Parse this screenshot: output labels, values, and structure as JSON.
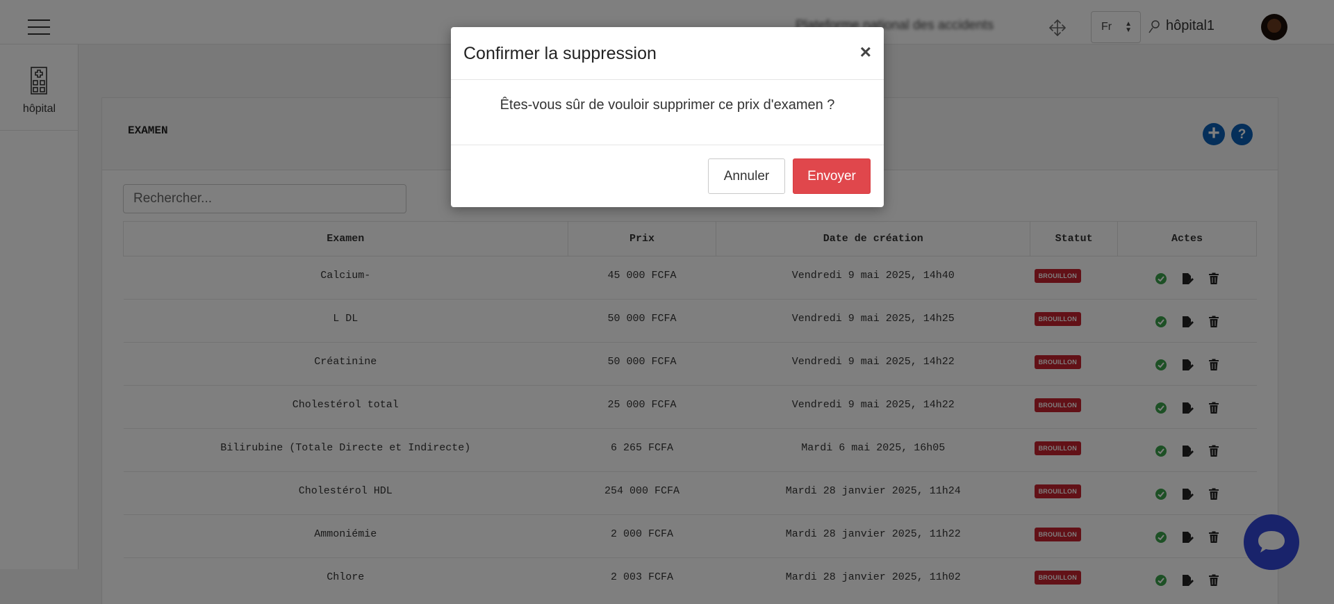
{
  "header": {
    "brand_text": "Plateforme national des accidents",
    "language": "Fr",
    "user_name": "hôpital1"
  },
  "sidebar": {
    "items": [
      {
        "label": "hôpital",
        "icon": "hospital-icon"
      }
    ]
  },
  "page": {
    "title": "EXAMEN",
    "search_placeholder": "Rechercher..."
  },
  "table": {
    "columns": [
      "Examen",
      "Prix",
      "Date de création",
      "Statut",
      "Actes"
    ],
    "rows": [
      {
        "examen": "Calcium-",
        "prix": "45 000 FCFA",
        "date": "Vendredi 9 mai 2025, 14h40",
        "statut": "BROUILLON"
      },
      {
        "examen": "L DL",
        "prix": "50 000 FCFA",
        "date": "Vendredi 9 mai 2025, 14h25",
        "statut": "BROUILLON"
      },
      {
        "examen": "Créatinine",
        "prix": "50 000 FCFA",
        "date": "Vendredi 9 mai 2025, 14h22",
        "statut": "BROUILLON"
      },
      {
        "examen": "Cholestérol total",
        "prix": "25 000 FCFA",
        "date": "Vendredi 9 mai 2025, 14h22",
        "statut": "BROUILLON"
      },
      {
        "examen": "Bilirubine (Totale Directe et Indirecte)",
        "prix": "6 265 FCFA",
        "date": "Mardi 6 mai 2025, 16h05",
        "statut": "BROUILLON"
      },
      {
        "examen": "Cholestérol HDL",
        "prix": "254 000 FCFA",
        "date": "Mardi 28 janvier 2025, 11h24",
        "statut": "BROUILLON"
      },
      {
        "examen": "Ammoniémie",
        "prix": "2 000 FCFA",
        "date": "Mardi 28 janvier 2025, 11h22",
        "statut": "BROUILLON"
      },
      {
        "examen": "Chlore",
        "prix": "2 003 FCFA",
        "date": "Mardi 28 janvier 2025, 11h02",
        "statut": "BROUILLON"
      }
    ]
  },
  "modal": {
    "title": "Confirmer la suppression",
    "close_label": "×",
    "message": "Êtes-vous sûr de vouloir supprimer ce prix d'examen ?",
    "cancel_label": "Annuler",
    "confirm_label": "Envoyer"
  },
  "colors": {
    "primary": "#0b5fb5",
    "danger_badge": "#c4232f",
    "confirm_button": "#e0474c",
    "validate_icon": "#3aa04a",
    "chat_button": "#3347d6"
  }
}
